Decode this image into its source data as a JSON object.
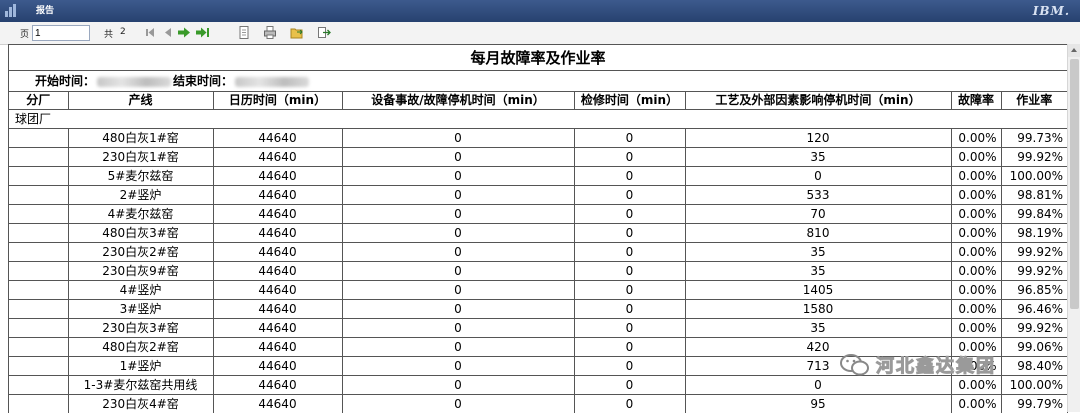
{
  "window": {
    "title": "报告",
    "brand": "IBM."
  },
  "toolbar": {
    "page_label": "页",
    "page_value": "1",
    "total_label": "共",
    "total_pages": "2"
  },
  "report": {
    "title": "每月故障率及作业率",
    "start_label": "开始时间：",
    "end_label": "结束时间：",
    "columns": [
      "分厂",
      "产线",
      "日历时间（min）",
      "设备事故/故障停机时间（min）",
      "检修时间（min）",
      "工艺及外部因素影响停机时间（min）",
      "故障率",
      "作业率"
    ],
    "group": "球团厂",
    "rows": [
      {
        "line": "480白灰1#窑",
        "cal": "44640",
        "fault": "0",
        "maint": "0",
        "ext": "120",
        "rate": "0.00%",
        "op": "99.73%"
      },
      {
        "line": "230白灰1#窑",
        "cal": "44640",
        "fault": "0",
        "maint": "0",
        "ext": "35",
        "rate": "0.00%",
        "op": "99.92%"
      },
      {
        "line": "5#麦尔兹窑",
        "cal": "44640",
        "fault": "0",
        "maint": "0",
        "ext": "0",
        "rate": "0.00%",
        "op": "100.00%"
      },
      {
        "line": "2#竖炉",
        "cal": "44640",
        "fault": "0",
        "maint": "0",
        "ext": "533",
        "rate": "0.00%",
        "op": "98.81%"
      },
      {
        "line": "4#麦尔兹窑",
        "cal": "44640",
        "fault": "0",
        "maint": "0",
        "ext": "70",
        "rate": "0.00%",
        "op": "99.84%"
      },
      {
        "line": "480白灰3#窑",
        "cal": "44640",
        "fault": "0",
        "maint": "0",
        "ext": "810",
        "rate": "0.00%",
        "op": "98.19%"
      },
      {
        "line": "230白灰2#窑",
        "cal": "44640",
        "fault": "0",
        "maint": "0",
        "ext": "35",
        "rate": "0.00%",
        "op": "99.92%"
      },
      {
        "line": "230白灰9#窑",
        "cal": "44640",
        "fault": "0",
        "maint": "0",
        "ext": "35",
        "rate": "0.00%",
        "op": "99.92%"
      },
      {
        "line": "4#竖炉",
        "cal": "44640",
        "fault": "0",
        "maint": "0",
        "ext": "1405",
        "rate": "0.00%",
        "op": "96.85%"
      },
      {
        "line": "3#竖炉",
        "cal": "44640",
        "fault": "0",
        "maint": "0",
        "ext": "1580",
        "rate": "0.00%",
        "op": "96.46%"
      },
      {
        "line": "230白灰3#窑",
        "cal": "44640",
        "fault": "0",
        "maint": "0",
        "ext": "35",
        "rate": "0.00%",
        "op": "99.92%"
      },
      {
        "line": "480白灰2#窑",
        "cal": "44640",
        "fault": "0",
        "maint": "0",
        "ext": "420",
        "rate": "0.00%",
        "op": "99.06%"
      },
      {
        "line": "1#竖炉",
        "cal": "44640",
        "fault": "0",
        "maint": "0",
        "ext": "713",
        "rate": "0.00%",
        "op": "98.40%"
      },
      {
        "line": "1-3#麦尔兹窑共用线",
        "cal": "44640",
        "fault": "0",
        "maint": "0",
        "ext": "0",
        "rate": "0.00%",
        "op": "100.00%"
      },
      {
        "line": "230白灰4#窑",
        "cal": "44640",
        "fault": "0",
        "maint": "0",
        "ext": "95",
        "rate": "0.00%",
        "op": "99.79%"
      },
      {
        "line": "",
        "cal": "",
        "fault": "",
        "maint": "",
        "ext": "",
        "rate": "",
        "op": ""
      }
    ]
  },
  "watermark": {
    "text": "河北鑫达集团"
  }
}
